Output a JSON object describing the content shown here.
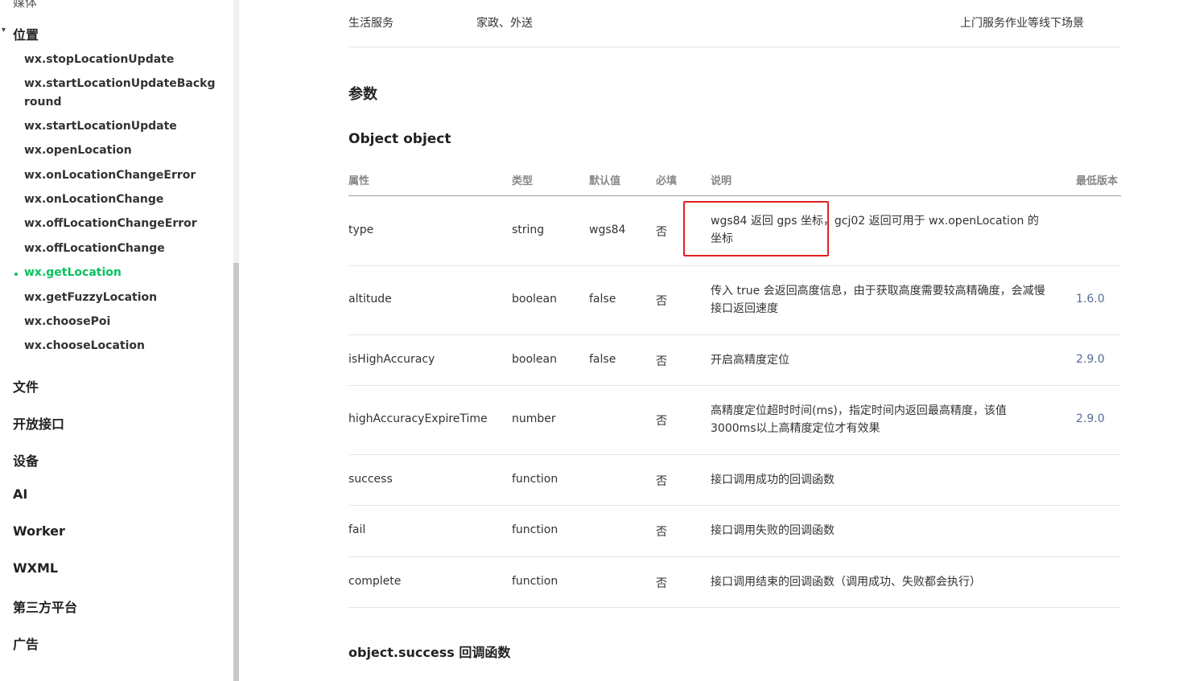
{
  "sidebar": {
    "cut_label": "媒体",
    "category": "位置",
    "items": [
      {
        "label": "wx.stopLocationUpdate",
        "active": false
      },
      {
        "label": "wx.startLocationUpdateBackground",
        "active": false
      },
      {
        "label": "wx.startLocationUpdate",
        "active": false
      },
      {
        "label": "wx.openLocation",
        "active": false
      },
      {
        "label": "wx.onLocationChangeError",
        "active": false
      },
      {
        "label": "wx.onLocationChange",
        "active": false
      },
      {
        "label": "wx.offLocationChangeError",
        "active": false
      },
      {
        "label": "wx.offLocationChange",
        "active": false
      },
      {
        "label": "wx.getLocation",
        "active": true
      },
      {
        "label": "wx.getFuzzyLocation",
        "active": false
      },
      {
        "label": "wx.choosePoi",
        "active": false
      },
      {
        "label": "wx.chooseLocation",
        "active": false
      }
    ],
    "sections": [
      "文件",
      "开放接口",
      "设备",
      "AI",
      "Worker",
      "WXML",
      "第三方平台",
      "广告"
    ]
  },
  "main": {
    "top_row": {
      "col1": "生活服务",
      "col2": "家政、外送",
      "col3": "上门服务作业等线下场景"
    },
    "params_heading": "参数",
    "object_heading": "Object object",
    "table": {
      "headers": [
        "属性",
        "类型",
        "默认值",
        "必填",
        "说明",
        "最低版本"
      ],
      "rows": [
        {
          "name": "type",
          "type": "string",
          "default": "wgs84",
          "required": "否",
          "desc": "wgs84 返回 gps 坐标，gcj02 返回可用于 wx.openLocation 的坐标",
          "version": ""
        },
        {
          "name": "altitude",
          "type": "boolean",
          "default": "false",
          "required": "否",
          "desc": "传入 true 会返回高度信息，由于获取高度需要较高精确度，会减慢接口返回速度",
          "version": "1.6.0"
        },
        {
          "name": "isHighAccuracy",
          "type": "boolean",
          "default": "false",
          "required": "否",
          "desc": "开启高精度定位",
          "version": "2.9.0"
        },
        {
          "name": "highAccuracyExpireTime",
          "type": "number",
          "default": "",
          "required": "否",
          "desc": "高精度定位超时时间(ms)，指定时间内返回最高精度，该值3000ms以上高精度定位才有效果",
          "version": "2.9.0"
        },
        {
          "name": "success",
          "type": "function",
          "default": "",
          "required": "否",
          "desc": "接口调用成功的回调函数",
          "version": ""
        },
        {
          "name": "fail",
          "type": "function",
          "default": "",
          "required": "否",
          "desc": "接口调用失败的回调函数",
          "version": ""
        },
        {
          "name": "complete",
          "type": "function",
          "default": "",
          "required": "否",
          "desc": "接口调用结束的回调函数（调用成功、失败都会执行）",
          "version": ""
        }
      ]
    },
    "success_heading": "object.success 回调函数"
  },
  "colors": {
    "accent": "#07c160",
    "link": "#576b95",
    "highlight": "#e52020"
  }
}
